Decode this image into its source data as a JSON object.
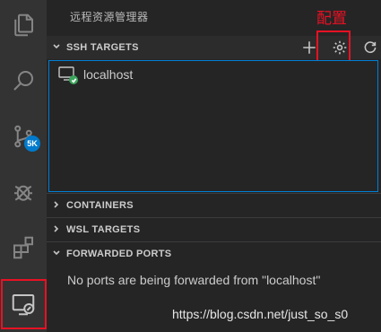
{
  "sidebar": {
    "title": "远程资源管理器",
    "annotation": "配置",
    "sections": {
      "ssh": {
        "label": "SSH TARGETS",
        "hosts": [
          {
            "label": "localhost"
          }
        ]
      },
      "containers": {
        "label": "CONTAINERS"
      },
      "wsl": {
        "label": "WSL TARGETS"
      },
      "forwarded": {
        "label": "FORWARDED PORTS",
        "empty_message": "No ports are being forwarded from \"localhost\""
      }
    }
  },
  "activity_bar": {
    "source_control_badge": "5K",
    "items": [
      "files-icon",
      "search-icon",
      "source-control-icon",
      "debug-icon",
      "extensions-icon",
      "remote-explorer-icon"
    ]
  },
  "watermark": "https://blog.csdn.net/just_so_s0",
  "colors": {
    "accent": "#007acc",
    "highlight": "#e81123",
    "status_ok": "#3ba55c"
  }
}
